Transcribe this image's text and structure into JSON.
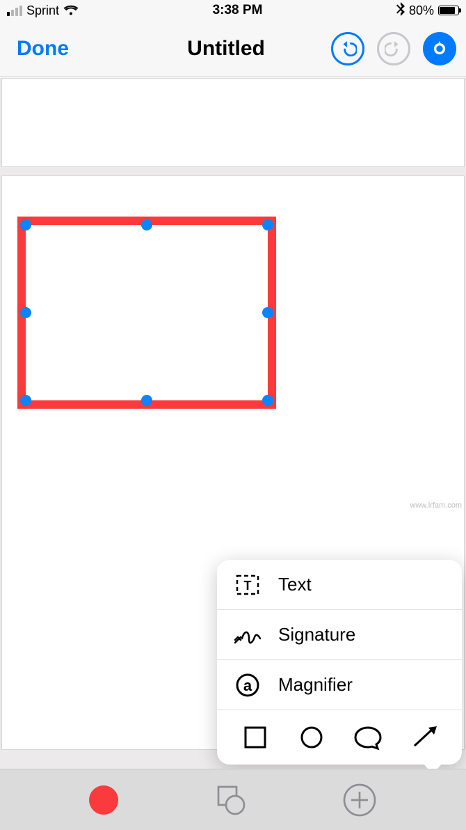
{
  "status": {
    "carrier": "Sprint",
    "time": "3:38 PM",
    "battery_pct": "80%"
  },
  "nav": {
    "done_label": "Done",
    "title": "Untitled"
  },
  "selection": {
    "stroke_color": "#fa3a3d",
    "handle_color": "#0a84ff"
  },
  "popover": {
    "items": [
      {
        "label": "Text"
      },
      {
        "label": "Signature"
      },
      {
        "label": "Magnifier"
      }
    ],
    "shapes": [
      "rectangle",
      "ellipse",
      "speech-bubble",
      "arrow"
    ]
  },
  "toolbar": {
    "current_color": "#fa3a3d"
  },
  "watermark": "www.lrfam.com"
}
